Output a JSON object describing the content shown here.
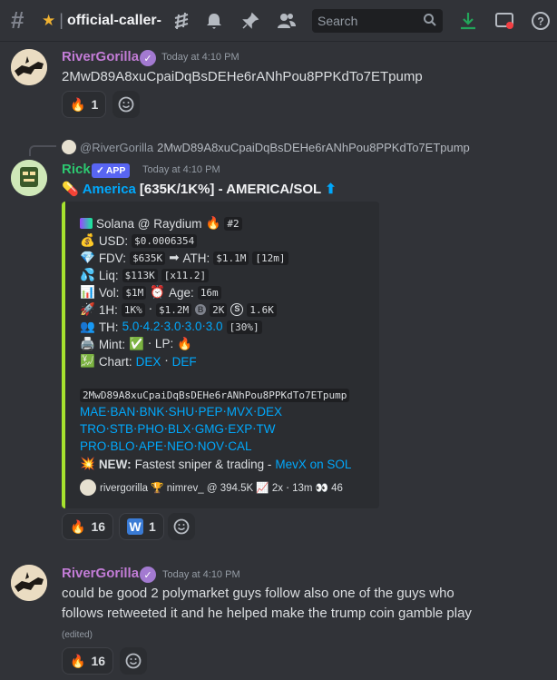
{
  "topbar": {
    "channel": "official-caller-",
    "search_placeholder": "Search"
  },
  "messages": [
    {
      "user": "RiverGorilla",
      "timestamp": "Today at 4:10 PM",
      "content": "2MwD89A8xuCpaiDqBsDEHe6rANhPou8PPKdTo7ETpump",
      "reaction_count": "1"
    },
    {
      "reply_user": "@RiverGorilla",
      "reply_text": "2MwD89A8xuCpaiDqBsDEHe6rANhPou8PPKdTo7ETpump",
      "user": "Rick",
      "app_label": "APP",
      "timestamp": "Today at 4:10 PM",
      "title_link": "America",
      "title_rest": "[635K/1K%] - AMERICA/SOL",
      "embed": {
        "line1": "Solana @ Raydium",
        "line1_tag": "#2",
        "usd_label": "USD:",
        "usd_value": "$0.0006354",
        "fdv_label": "FDV:",
        "fdv_value": "$635K",
        "ath_label": "ATH:",
        "ath_value": "$1.1M",
        "ath_time": "[12m]",
        "liq_label": "Liq:",
        "liq_value": "$113K",
        "liq_mult": "[x11.2]",
        "vol_label": "Vol:",
        "vol_value": "$1M",
        "age_label": "Age:",
        "age_value": "16m",
        "h1_label": "1H:",
        "h1_pct": "1K%",
        "h1_vol": "$1.2M",
        "h1_buys": "2K",
        "h1_sells": "1.6K",
        "th_label": "TH:",
        "th_values": "5.0⋅4.2⋅3.0⋅3.0⋅3.0",
        "th_total": "[30%]",
        "mint_label": "Mint:",
        "lp_label": "⋅ LP:",
        "chart_label": "Chart:",
        "chart_dex": "DEX",
        "chart_def": "DEF",
        "address": "2MwD89A8xuCpaiDqBsDEHe6rANhPou8PPKdTo7ETpump",
        "links1": "MAE⋅BAN⋅BNK⋅SHU⋅PEP⋅MVX⋅DEX",
        "links2": "TRO⋅STB⋅PHO⋅BLX⋅GMG⋅EXP⋅TW",
        "links3": "PRO⋅BLO⋅APE⋅NEO⋅NOV⋅CAL",
        "new_label": "NEW:",
        "new_text": "Fastest sniper & trading -",
        "new_link": "MevX on SOL",
        "footer": "rivergorilla 🏆 nimrev_ @ 394.5K 📈 2x ⋅ 13m 👀 46"
      },
      "reaction1_count": "16",
      "reaction2_count": "1"
    },
    {
      "user": "RiverGorilla",
      "timestamp": "Today at 4:10 PM",
      "line1": "could be good 2 polymarket guys follow also one of the guys who",
      "line2": "follows retweeted it and he helped make the trump coin gamble play",
      "edited": "(edited)",
      "reaction_count": "16"
    }
  ],
  "colors": {
    "background": "#313338",
    "username_purple": "#c27cd6",
    "username_green": "#2dc770",
    "link_blue": "#00a8fc",
    "embed_border": "#a6e22e"
  }
}
